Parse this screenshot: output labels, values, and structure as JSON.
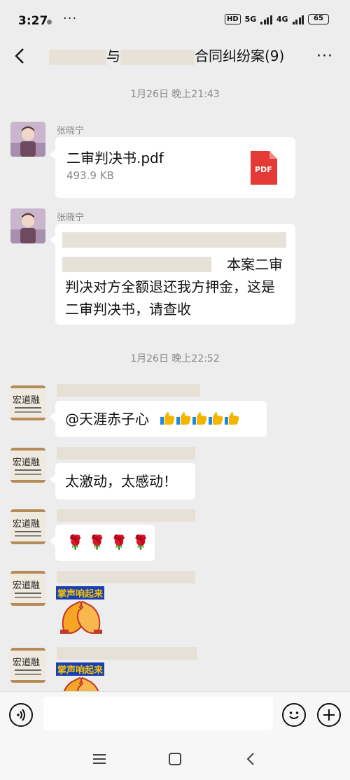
{
  "status_bar": {
    "time": "3:27",
    "network1": "5G",
    "network2": "4G",
    "hd_label": "HD",
    "battery": "65"
  },
  "header": {
    "title_part1": "与",
    "title_part2": "合同纠纷案(9)"
  },
  "chat": {
    "timestamp1": "1月26日 晚上21:43",
    "timestamp2": "1月26日 晚上22:52",
    "msg1": {
      "sender": "张晓宁",
      "file_name": "二审判决书.pdf",
      "file_size": "493.9 KB",
      "file_badge": "PDF"
    },
    "msg2": {
      "sender": "张晓宁",
      "text_end": "本案二审",
      "line3": "判决对方全额退还我方押金，这是",
      "line4": "二审判决书，请查收"
    },
    "msg3": {
      "text": "@天涯赤子心"
    },
    "msg4": {
      "text": "太激动，太感动！"
    },
    "msg5": {
      "text": "🌹 🌹 🌹 🌹"
    },
    "msg6": {
      "sticker_text": "掌声响起来"
    },
    "msg7": {
      "sticker_text": "掌声响起来"
    }
  },
  "colors": {
    "background": "#ededed",
    "bubble": "#ffffff",
    "pdf_red": "#e53935",
    "redacted": "#e7e1d7",
    "thumb_yellow": "#f4b400"
  }
}
